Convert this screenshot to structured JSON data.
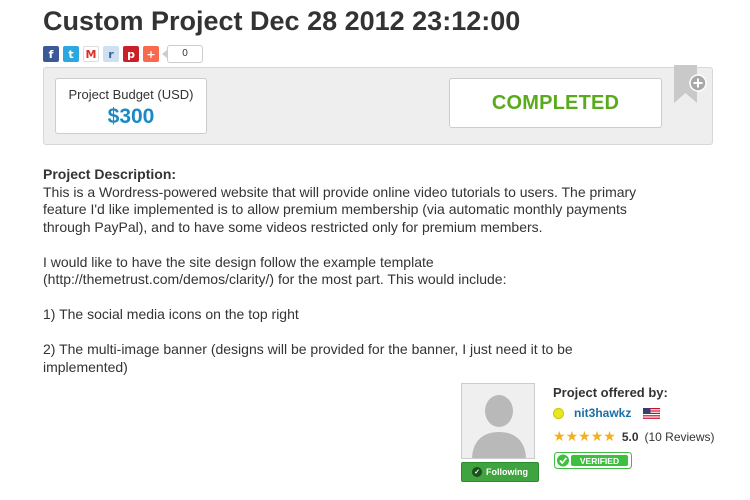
{
  "project": {
    "title": "Custom Project Dec 28 2012 23:12:00",
    "budget_label": "Project Budget (USD)",
    "budget_value": "$300",
    "status": "COMPLETED"
  },
  "share": {
    "buttons": [
      {
        "icon": "facebook-icon",
        "glyph": "f",
        "color": "#3b5998"
      },
      {
        "icon": "twitter-icon",
        "glyph": "t",
        "color": "#2aa9e0"
      },
      {
        "icon": "gmail-icon",
        "glyph": "M",
        "color": "#d93025"
      },
      {
        "icon": "reddit-icon",
        "glyph": "r",
        "color": "#8fb3d9"
      },
      {
        "icon": "pinterest-icon",
        "glyph": "p",
        "color": "#cb2027"
      },
      {
        "icon": "addthis-plus-icon",
        "glyph": "+",
        "color": "#f8694d"
      }
    ],
    "count": "0"
  },
  "description": {
    "heading": "Project Description:",
    "paragraphs": [
      "This is a Wordress-powered website that will provide online video tutorials to users. The primary feature I'd like implemented is to allow premium membership (via automatic monthly payments through PayPal), and to have some videos restricted only for premium members.",
      "I would like to have the site design follow the example template (http://themetrust.com/demos/clarity/) for the most part. This would include:",
      "1) The social media icons on the top right",
      "2) The multi-image banner (designs will be provided for the banner, I just need it to be implemented)"
    ]
  },
  "offered_by": {
    "label": "Project offered by:",
    "username": "nit3hawkz",
    "rating": 5.0,
    "rating_text": "5.0",
    "reviews": "(10 Reviews)",
    "following_label": "Following",
    "verified_label": "VERIFIED"
  },
  "colors": {
    "budget": "#1a8ac6",
    "status": "#5aab1c",
    "username": "#1a6fa8",
    "following": "#3fa33f",
    "verified": "#3fbf3f"
  }
}
